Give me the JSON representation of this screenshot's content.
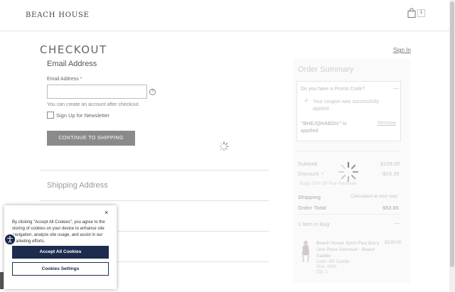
{
  "header": {
    "logo": "BEACH HOUSE",
    "bag_icon": "shopping-bag-icon",
    "bag_count": "1"
  },
  "checkout": {
    "title": "CHECKOUT",
    "sign_in": "Sign In",
    "email_section_title": "Email Address",
    "email_label": "Email Address",
    "required_mark": "*",
    "email_value": "",
    "help_icon": "question-circle-icon",
    "help_glyph": "?",
    "email_hint": "You can create an account after checkout.",
    "newsletter_label": "Sign Up for Newsletter",
    "continue_button": "CONTINUE TO SHIPPING",
    "shipping_section_title": "Shipping Address"
  },
  "summary": {
    "title": "Order Summary",
    "promo_question": "Do you have a Promo Code?",
    "promo_toggle": "—",
    "promo_check": "✔",
    "promo_success": "Your coupon was successfully applied.",
    "promo_code_text": "\"BHEJQHABDis\" is applied",
    "promo_remove": "Remove",
    "subtotal_label": "Subtotal",
    "subtotal_value": "$109.00",
    "discount_label": "Discount",
    "discount_value": "-$16.35",
    "discount_note": "Enjoy 15% Off Your Purchase",
    "shipping_label": "Shipping",
    "shipping_value": "Calculated at next step",
    "total_label": "Order Total",
    "total_value": "$92.65",
    "items_label": "1 Item in Bag",
    "items_toggle": "—",
    "item": {
      "name": "Beach House Sport Plea Barry One Piece Swimsuit - Beach Saddle",
      "price": "$109.00",
      "color": "Color: BR Saddle",
      "size": "Size: XSM",
      "qty": "Qty: 1"
    }
  },
  "cookie": {
    "close": "×",
    "text": "By clicking \"Accept All Cookies\", you agree to the storing of cookies on your device to enhance site navigation, analyze site usage, and assist in our marketing efforts.",
    "accept": "Accept All Cookies",
    "settings": "Cookies Settings",
    "accessibility_icon": "accessibility-icon"
  },
  "colors": {
    "button_gray": "#8a8a8a",
    "cookie_navy": "#1c2b4e"
  }
}
